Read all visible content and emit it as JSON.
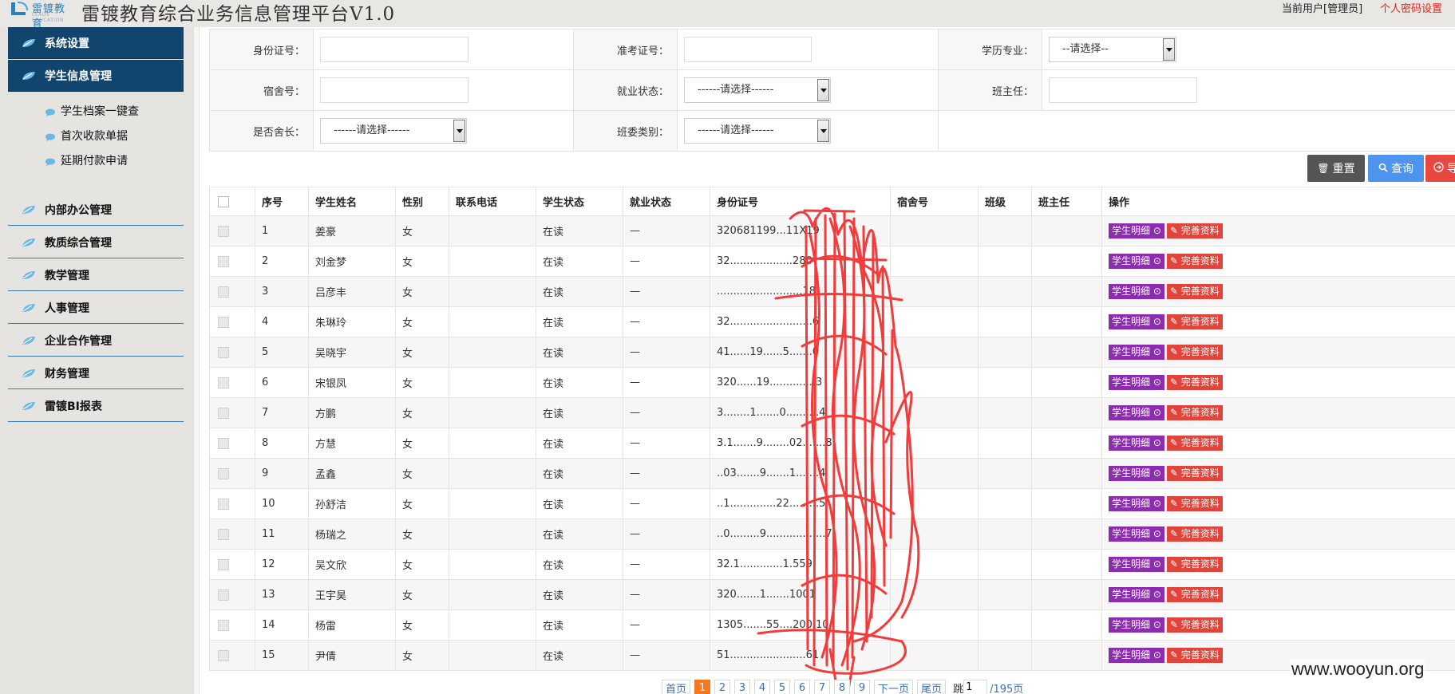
{
  "header": {
    "logo_text": "雷镀教育",
    "logo_sub": "LEADS EDUCATION",
    "title": "雷镀教育综合业务信息管理平台V1.0",
    "current_user": "当前用户[管理员]",
    "password_link": "个人密码设置"
  },
  "colors": {
    "sidebar_active": "#11456d",
    "divider": "#3a7bb5",
    "reset_btn": "#555555",
    "query_btn": "#4d94ef",
    "export_btn": "#e8483f",
    "detail_btn": "#8c2cae",
    "edit_btn": "#e0443b",
    "page_active": "#f37820",
    "redaction": "#f23232"
  },
  "sidebar": {
    "items": [
      {
        "label": "系统设置",
        "icon": "leaf-icon",
        "active": true
      },
      {
        "label": "学生信息管理",
        "icon": "leaf-icon",
        "active": true
      },
      {
        "label": "内部办公管理",
        "icon": "leaf-icon"
      },
      {
        "label": "教质综合管理",
        "icon": "leaf-icon"
      },
      {
        "label": "教学管理",
        "icon": "leaf-icon"
      },
      {
        "label": "人事管理",
        "icon": "leaf-icon"
      },
      {
        "label": "企业合作管理",
        "icon": "leaf-icon"
      },
      {
        "label": "财务管理",
        "icon": "leaf-icon"
      },
      {
        "label": "雷镀BI报表",
        "icon": "leaf-icon"
      }
    ],
    "subitems": [
      {
        "label": "学生档案一键查",
        "icon": "chat-bubble-icon"
      },
      {
        "label": "首次收款单据",
        "icon": "chat-bubble-icon"
      },
      {
        "label": "延期付款申请",
        "icon": "chat-bubble-icon"
      }
    ]
  },
  "filters": {
    "id_card": {
      "label": "身份证号："
    },
    "exam_no": {
      "label": "准考证号："
    },
    "major": {
      "label": "学历专业：",
      "value": "--请选择--"
    },
    "dorm": {
      "label": "宿舍号："
    },
    "employment": {
      "label": "就业状态：",
      "value": "------请选择------"
    },
    "head_teacher": {
      "label": "班主任："
    },
    "dorm_leader": {
      "label": "是否舍长：",
      "value": "------请选择------"
    },
    "committee": {
      "label": "班委类别：",
      "value": "------请选择------"
    }
  },
  "buttons": {
    "reset": "重置",
    "query": "查询",
    "export": "导"
  },
  "table": {
    "headers": [
      "序号",
      "学生姓名",
      "性别",
      "联系电话",
      "学生状态",
      "就业状态",
      "身份证号",
      "宿舍号",
      "班级",
      "班主任",
      "操作"
    ],
    "detail_label": "学生明细",
    "edit_label": "完善资料",
    "rows": [
      {
        "no": "1",
        "name": "姜豪",
        "gender": "女",
        "phone": "",
        "status": "在读",
        "employment": "—",
        "id_fragment": "320681199...11X19"
      },
      {
        "no": "2",
        "name": "刘金梦",
        "gender": "女",
        "phone": "",
        "status": "在读",
        "employment": "—",
        "id_fragment": "32...................280"
      },
      {
        "no": "3",
        "name": "吕彦丰",
        "gender": "女",
        "phone": "",
        "status": "在读",
        "employment": "—",
        "id_fragment": "..........................18"
      },
      {
        "no": "4",
        "name": "朱琳玲",
        "gender": "女",
        "phone": "",
        "status": "在读",
        "employment": "—",
        "id_fragment": "32.........................6"
      },
      {
        "no": "5",
        "name": "吴晓宇",
        "gender": "女",
        "phone": "",
        "status": "在读",
        "employment": "—",
        "id_fragment": "41......19......5.......0"
      },
      {
        "no": "6",
        "name": "宋银凤",
        "gender": "女",
        "phone": "",
        "status": "在读",
        "employment": "—",
        "id_fragment": "320......19..............3"
      },
      {
        "no": "7",
        "name": "方鹏",
        "gender": "女",
        "phone": "",
        "status": "在读",
        "employment": "—",
        "id_fragment": "3........1.......0..........4"
      },
      {
        "no": "8",
        "name": "方慧",
        "gender": "女",
        "phone": "",
        "status": "在读",
        "employment": "—",
        "id_fragment": "3.1.......9........02.......8"
      },
      {
        "no": "9",
        "name": "孟鑫",
        "gender": "女",
        "phone": "",
        "status": "在读",
        "employment": "—",
        "id_fragment": "..03.......9.......1.......4"
      },
      {
        "no": "10",
        "name": "孙舒洁",
        "gender": "女",
        "phone": "",
        "status": "在读",
        "employment": "—",
        "id_fragment": "..1..............22.........5"
      },
      {
        "no": "11",
        "name": "杨瑞之",
        "gender": "女",
        "phone": "",
        "status": "在读",
        "employment": "—",
        "id_fragment": "..0.........9..................7"
      },
      {
        "no": "12",
        "name": "吴文欣",
        "gender": "女",
        "phone": "",
        "status": "在读",
        "employment": "—",
        "id_fragment": "32.1.............1.559"
      },
      {
        "no": "13",
        "name": "王宇昊",
        "gender": "女",
        "phone": "",
        "status": "在读",
        "employment": "—",
        "id_fragment": "320.......1.......1001"
      },
      {
        "no": "14",
        "name": "杨雷",
        "gender": "女",
        "phone": "",
        "status": "在读",
        "employment": "—",
        "id_fragment": "1305.......55....200.10"
      },
      {
        "no": "15",
        "name": "尹倩",
        "gender": "女",
        "phone": "",
        "status": "在读",
        "employment": "—",
        "id_fragment": "51.......................61"
      }
    ]
  },
  "pagination": {
    "first": "首页",
    "pages": [
      "1",
      "2",
      "3",
      "4",
      "5",
      "6",
      "7",
      "8",
      "9"
    ],
    "current": "1",
    "next": "下一页",
    "last": "尾页",
    "jump_label": "跳",
    "jump_value": "1",
    "total": "/195页"
  },
  "watermark": "www.wooyun.org"
}
